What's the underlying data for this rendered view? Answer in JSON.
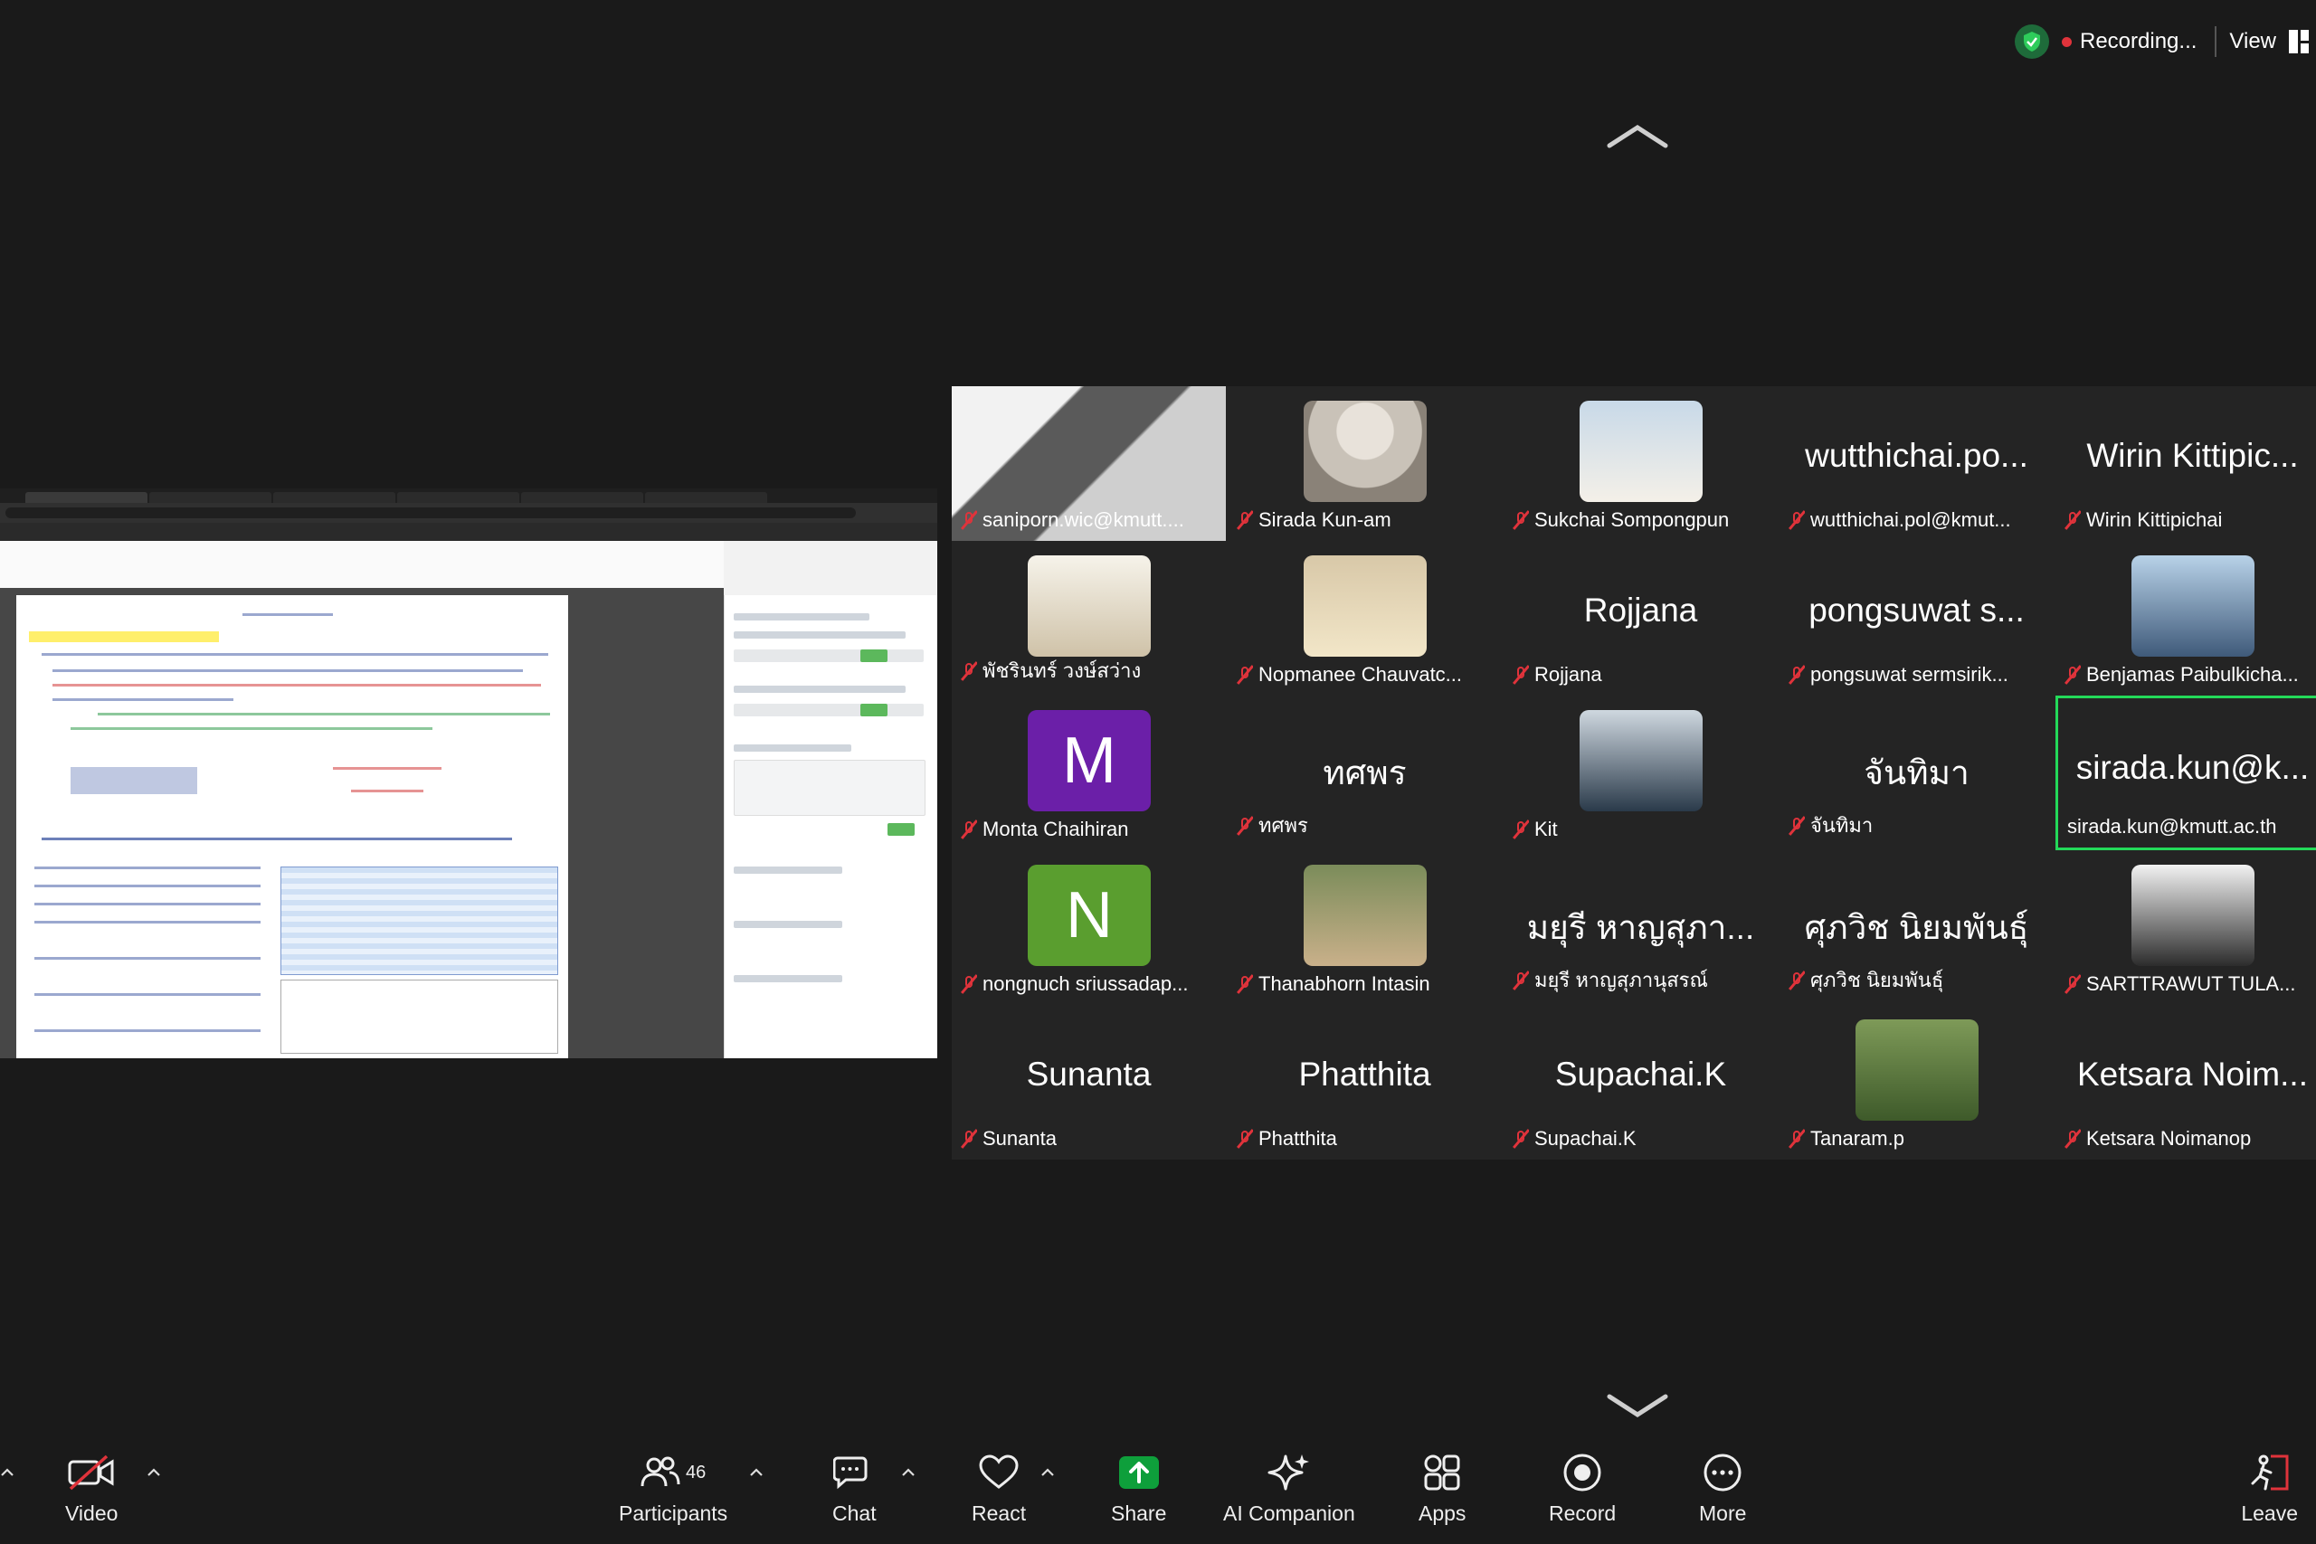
{
  "status": {
    "recording_label": "Recording...",
    "view_label": "View"
  },
  "gallery": [
    {
      "name": "saniporn.wic@kmutt....",
      "big": "",
      "kind": "photo-full"
    },
    {
      "name": "Sirada Kun-am",
      "big": "",
      "kind": "photo"
    },
    {
      "name": "Sukchai Sompongpun",
      "big": "",
      "kind": "photo"
    },
    {
      "name": "wutthichai.pol@kmut...",
      "big": "wutthichai.po...",
      "kind": "text"
    },
    {
      "name": "Wirin Kittipichai",
      "big": "Wirin Kittipic...",
      "kind": "text"
    },
    {
      "name": "พัชรินทร์ วงษ์สว่าง",
      "big": "",
      "kind": "photo"
    },
    {
      "name": "Nopmanee Chauvatc...",
      "big": "",
      "kind": "photo"
    },
    {
      "name": "Rojjana",
      "big": "Rojjana",
      "kind": "text"
    },
    {
      "name": "pongsuwat  sermsirik...",
      "big": "pongsuwat  s...",
      "kind": "text"
    },
    {
      "name": "Benjamas Paibulkicha...",
      "big": "",
      "kind": "photo"
    },
    {
      "name": "Monta Chaihiran",
      "big": "M",
      "kind": "letter",
      "color": "#6b1fa8"
    },
    {
      "name": "ทศพร",
      "big": "ทศพร",
      "kind": "text"
    },
    {
      "name": "Kit",
      "big": "",
      "kind": "photo"
    },
    {
      "name": "จันทิมา",
      "big": "จันทิมา",
      "kind": "text"
    },
    {
      "name": "sirada.kun@kmutt.ac.th",
      "big": "sirada.kun@k...",
      "kind": "text",
      "active": true
    },
    {
      "name": "nongnuch sriussadap...",
      "big": "N",
      "kind": "letter",
      "color": "#5a9e2f"
    },
    {
      "name": "Thanabhorn Intasin",
      "big": "",
      "kind": "photo"
    },
    {
      "name": "มยุรี หาญสุภานุสรณ์",
      "big": "มยุรี หาญสุภา...",
      "kind": "text"
    },
    {
      "name": "ศุภวิช นิยมพันธุ์",
      "big": "ศุภวิช นิยมพันธุ์",
      "kind": "text"
    },
    {
      "name": "SARTTRAWUT TULA...",
      "big": "",
      "kind": "photo"
    },
    {
      "name": "Sunanta",
      "big": "Sunanta",
      "kind": "text"
    },
    {
      "name": "Phatthita",
      "big": "Phatthita",
      "kind": "text"
    },
    {
      "name": "Supachai.K",
      "big": "Supachai.K",
      "kind": "text"
    },
    {
      "name": "Tanaram.p",
      "big": "",
      "kind": "photo"
    },
    {
      "name": "Ketsara Noimanop",
      "big": "Ketsara Noim...",
      "kind": "text"
    }
  ],
  "toolbar": {
    "video": "Video",
    "participants": "Participants",
    "participants_count": "46",
    "chat": "Chat",
    "react": "React",
    "share": "Share",
    "ai": "AI Companion",
    "apps": "Apps",
    "record": "Record",
    "more": "More",
    "leave": "Leave"
  },
  "colors": {
    "active_speaker": "#23d959",
    "share_green": "#0e9f3b",
    "muted_red": "#e0333b"
  }
}
